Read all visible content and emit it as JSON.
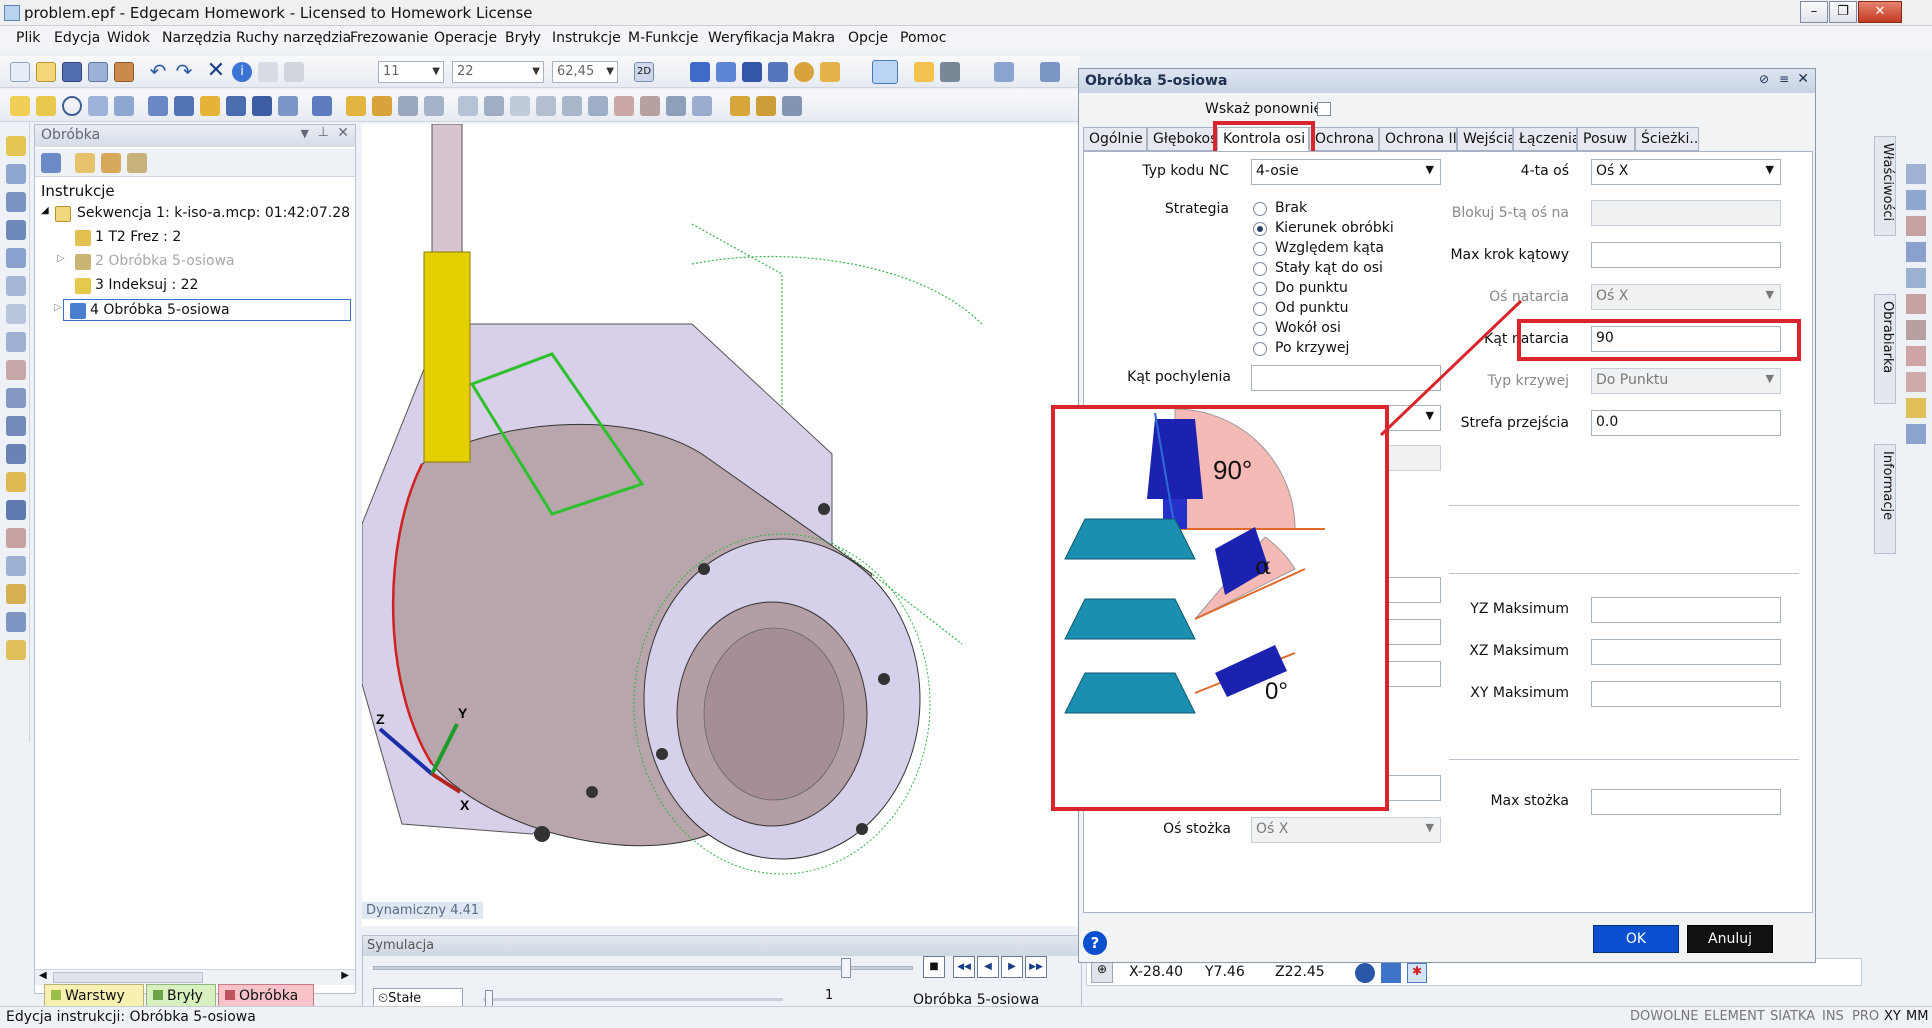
{
  "window": {
    "title": "problem.epf - Edgecam Homework - Licensed to Homework License",
    "minimize": "–",
    "restore": "❐",
    "close": "✕"
  },
  "menu": [
    "Plik",
    "Edycja",
    "Widok",
    "Narzędzia",
    "Ruchy narzędzia",
    "Frezowanie",
    "Operacje",
    "Bryły",
    "Instrukcje",
    "M-Funkcje",
    "Weryfikacja",
    "Makra",
    "Opcje",
    "Pomoc"
  ],
  "toolbar": {
    "combo1": "11",
    "combo2": "22",
    "combo3": "62,45"
  },
  "left_panel": {
    "title": "Obróbka",
    "header": "Instrukcje",
    "tree": [
      {
        "label": "Sekwencja 1: k-iso-a.mcp: 01:42:07.28",
        "disabled": false,
        "selected": false
      },
      {
        "label": "1 T2 Frez : 2",
        "disabled": false,
        "selected": false
      },
      {
        "label": "2 Obróbka 5-osiowa",
        "disabled": true,
        "selected": false
      },
      {
        "label": "3 Indeksuj : 22",
        "disabled": false,
        "selected": false
      },
      {
        "label": "4 Obróbka 5-osiowa",
        "disabled": false,
        "selected": true
      }
    ],
    "bottom_tabs": [
      "Warstwy",
      "Bryły",
      "Obróbka"
    ]
  },
  "viewport": {
    "label": "Dynamiczny 4.41",
    "axis_x": "X",
    "axis_y": "Y",
    "axis_z": "Z"
  },
  "simulation": {
    "title": "Symulacja",
    "mode": "Stałe",
    "step": "1",
    "status": "Obróbka 5-osiowa"
  },
  "dialog": {
    "title": "Obróbka 5-osiowa",
    "show_again_label": "Wskaż ponownie",
    "tabs": [
      "Ogólnie",
      "Głębokość",
      "Kontrola osi",
      "Ochrona I",
      "Ochrona II",
      "Wejścia",
      "Łączenia",
      "Posuw",
      "Ścieżki..."
    ],
    "active_tab": "Kontrola osi",
    "nc_code_label": "Typ kodu NC",
    "nc_code_value": "4-osie",
    "axis4_label": "4-ta oś",
    "axis4_value": "Oś X",
    "strategy_label": "Strategia",
    "strategies": [
      "Brak",
      "Kierunek obróbki",
      "Względem kąta",
      "Stały kąt do osi",
      "Do punktu",
      "Od punktu",
      "Wokół osi",
      "Po krzywej"
    ],
    "selected_strategy": "Kierunek obróbki",
    "lock5_label": "Blokuj 5-tą oś na",
    "max_step_label": "Max krok kątowy",
    "lead_axis_label": "Oś natarcia",
    "lead_axis_value": "Oś X",
    "lead_angle_label": "Kąt natarcia",
    "lead_angle_value": "90",
    "tilt_label": "Kąt pochylenia",
    "curve_type_label": "Typ krzywej",
    "curve_type_value": "Do Punktu",
    "transition_label": "Strefa przejścia",
    "transition_value": "0.0",
    "yz_label": "YZ Maksimum",
    "xz_label": "XZ Maksimum",
    "xy_label": "XY Maksimum",
    "max_cone_label": "Max stożka",
    "cone_axis_label": "Oś stożka",
    "cone_axis_value": "Oś X",
    "ok": "OK",
    "cancel": "Anuluj",
    "help": "?",
    "illustration": {
      "angle_90": "90°",
      "angle_alpha": "α",
      "angle_0": "0°"
    }
  },
  "coords": {
    "x": "X-28.40",
    "y": "Y7.46",
    "z": "Z22.45"
  },
  "right_sidebar": [
    "Właściwości",
    "Obrabiarka",
    "Informacje"
  ],
  "status": {
    "left": "Edycja instrukcji: Obróbka 5-osiowa",
    "indicators": [
      "DOWOLNE",
      "ELEMENT",
      "SIATKA",
      "INS",
      "PRO",
      "XY",
      "MM"
    ]
  }
}
